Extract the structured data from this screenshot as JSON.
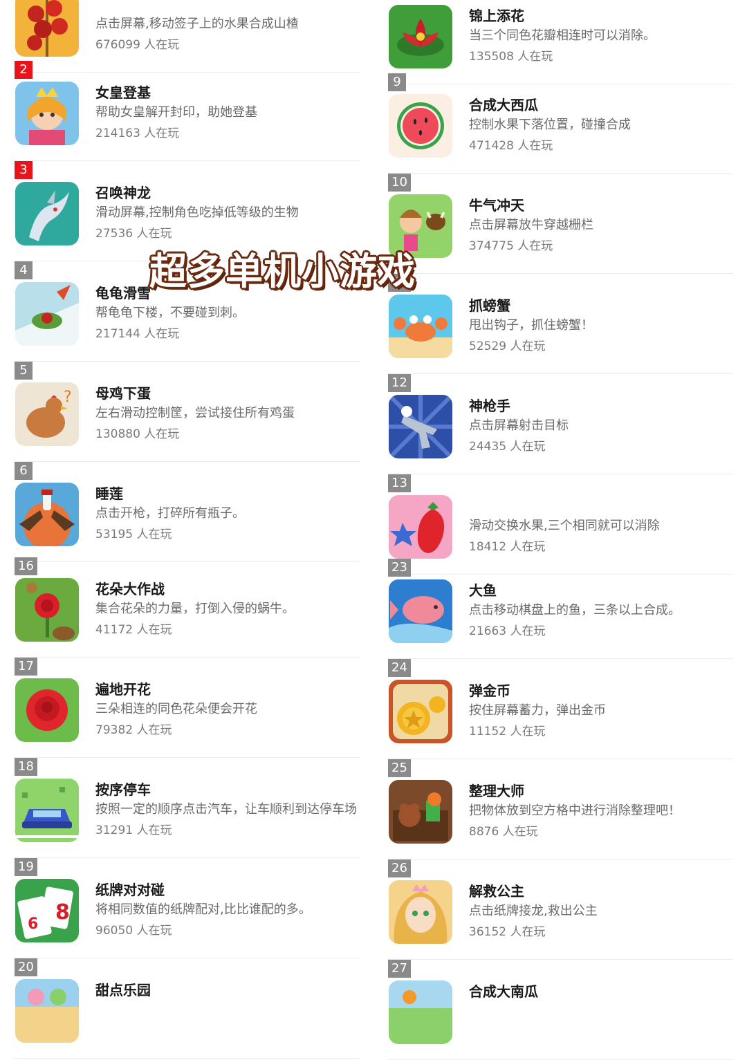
{
  "overlay_text": "超多单机小游戏",
  "players_suffix": "人在玩",
  "left": [
    {
      "rank": "",
      "title": "",
      "desc": "点击屏幕,移动签子上的水果合成山楂",
      "players": "676099 人在玩",
      "icon": "hawthorn-icon"
    },
    {
      "rank": "2",
      "title": "女皇登基",
      "desc": "帮助女皇解开封印，助她登基",
      "players": "214163 人在玩",
      "icon": "queen-icon"
    },
    {
      "rank": "3",
      "title": "召唤神龙",
      "desc": "滑动屏幕,控制角色吃掉低等级的生物",
      "players": "27536 人在玩",
      "icon": "dragon-icon"
    },
    {
      "rank": "4",
      "title": "龟龟滑雪",
      "desc": "帮龟龟下楼，不要碰到刺。",
      "players": "217144 人在玩",
      "icon": "turtle-icon"
    },
    {
      "rank": "5",
      "title": "母鸡下蛋",
      "desc": "左右滑动控制筐，尝试接住所有鸡蛋",
      "players": "130880 人在玩",
      "icon": "hen-icon"
    },
    {
      "rank": "6",
      "title": "睡莲",
      "desc": "点击开枪，打碎所有瓶子。",
      "players": "53195 人在玩",
      "icon": "pistols-icon"
    },
    {
      "rank": "16",
      "title": "花朵大作战",
      "desc": "集合花朵的力量，打倒入侵的蜗牛。",
      "players": "41172 人在玩",
      "icon": "flower-snail-icon"
    },
    {
      "rank": "17",
      "title": "遍地开花",
      "desc": "三朵相连的同色花朵便会开花",
      "players": "79382 人在玩",
      "icon": "rose-icon"
    },
    {
      "rank": "18",
      "title": "按序停车",
      "desc": "按照一定的顺序点击汽车，让车顺利到达停车场",
      "players": "31291 人在玩",
      "icon": "car-icon"
    },
    {
      "rank": "19",
      "title": "纸牌对对碰",
      "desc": "将相同数值的纸牌配对,比比谁配的多。",
      "players": "96050 人在玩",
      "icon": "cards-icon"
    },
    {
      "rank": "20",
      "title": "甜点乐园",
      "desc": "",
      "players": "",
      "icon": "dessert-icon"
    }
  ],
  "right": [
    {
      "rank": "",
      "title": "锦上添花",
      "desc": "当三个同色花瓣相连时可以消除。",
      "players": "135508 人在玩",
      "icon": "lotus-icon"
    },
    {
      "rank": "9",
      "title": "合成大西瓜",
      "desc": "控制水果下落位置，碰撞合成",
      "players": "471428 人在玩",
      "icon": "watermelon-icon"
    },
    {
      "rank": "10",
      "title": "牛气冲天",
      "desc": "点击屏幕放牛穿越栅栏",
      "players": "374775 人在玩",
      "icon": "cow-icon"
    },
    {
      "rank": "11",
      "title": "抓螃蟹",
      "desc": "甩出钩子，抓住螃蟹！",
      "players": "52529 人在玩",
      "icon": "crab-icon"
    },
    {
      "rank": "12",
      "title": "神枪手",
      "desc": "点击屏幕射击目标",
      "players": "24435 人在玩",
      "icon": "revolver-icon"
    },
    {
      "rank": "13",
      "title": "",
      "desc": "滑动交换水果,三个相同就可以消除",
      "players": "18412 人在玩",
      "icon": "strawberry-icon"
    },
    {
      "rank": "23",
      "title": "大鱼",
      "desc": "点击移动棋盘上的鱼，三条以上合成。",
      "players": "21663 人在玩",
      "icon": "fish-icon"
    },
    {
      "rank": "24",
      "title": "弹金币",
      "desc": "按住屏幕蓄力，弹出金币",
      "players": "11152 人在玩",
      "icon": "coin-icon"
    },
    {
      "rank": "25",
      "title": "整理大师",
      "desc": "把物体放到空方格中进行消除整理吧！",
      "players": "8876 人在玩",
      "icon": "toybox-icon"
    },
    {
      "rank": "26",
      "title": "解救公主",
      "desc": "点击纸牌接龙,救出公主",
      "players": "36152 人在玩",
      "icon": "princess-icon"
    },
    {
      "rank": "27",
      "title": "合成大南瓜",
      "desc": "",
      "players": "",
      "icon": "pumpkin-icon"
    }
  ]
}
